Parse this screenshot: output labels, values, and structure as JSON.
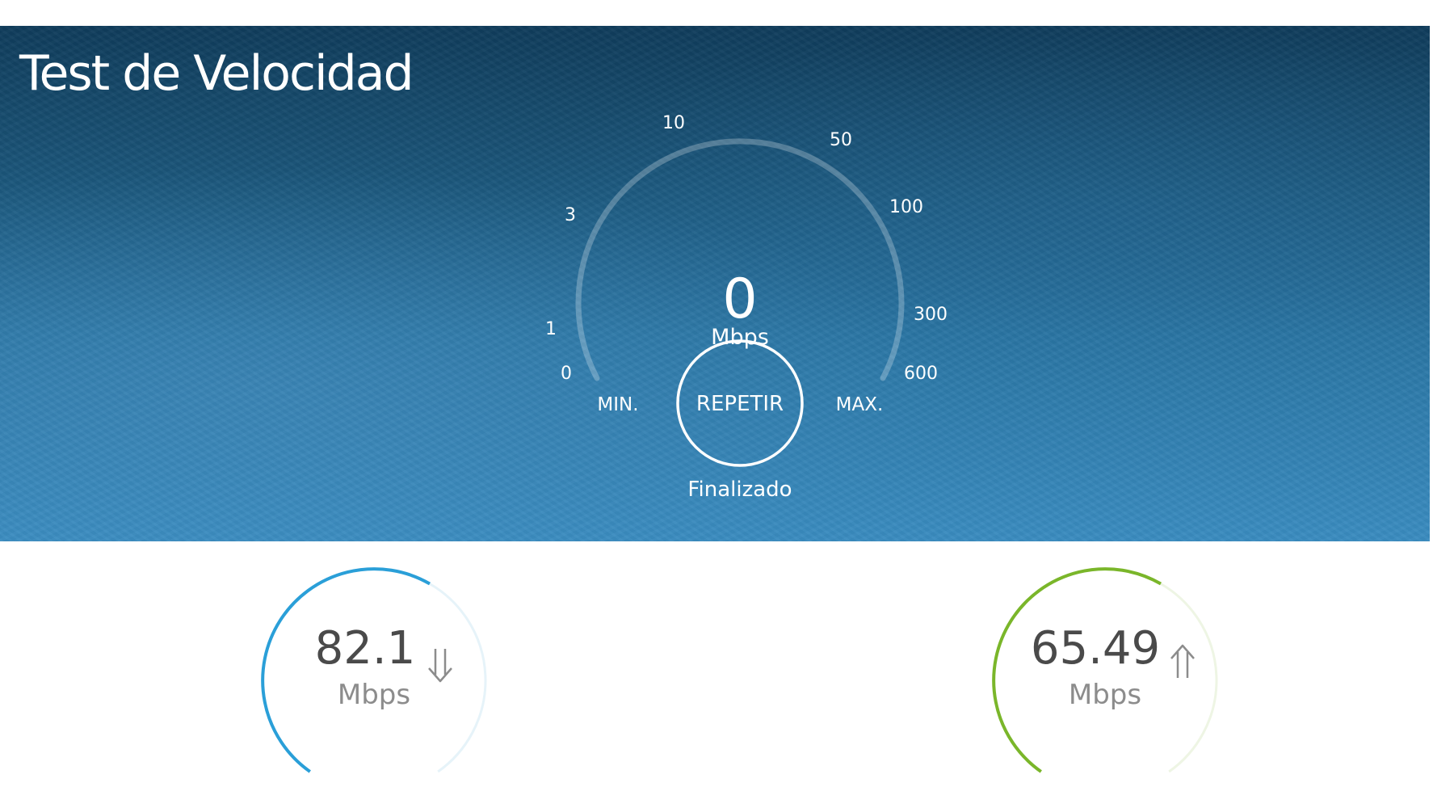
{
  "header": {
    "title": "Test de Velocidad"
  },
  "gauge": {
    "ticks": [
      "0",
      "1",
      "3",
      "10",
      "50",
      "100",
      "300",
      "600"
    ],
    "min_label": "MIN.",
    "max_label": "MAX.",
    "current_value": "0",
    "unit": "Mbps",
    "button_label": "REPETIR",
    "status": "Finalizado"
  },
  "results": {
    "download": {
      "value": "82.1",
      "unit": "Mbps",
      "icon": "download-arrow-icon",
      "color": "#2a9fd8"
    },
    "upload": {
      "value": "65.49",
      "unit": "Mbps",
      "icon": "upload-arrow-icon",
      "color": "#7ab62a"
    }
  },
  "colors": {
    "hero_top": "#0f3c5b",
    "hero_bottom": "#3a8cc0",
    "text_dark": "#4a4a4a",
    "text_muted": "#8c8c8c"
  }
}
